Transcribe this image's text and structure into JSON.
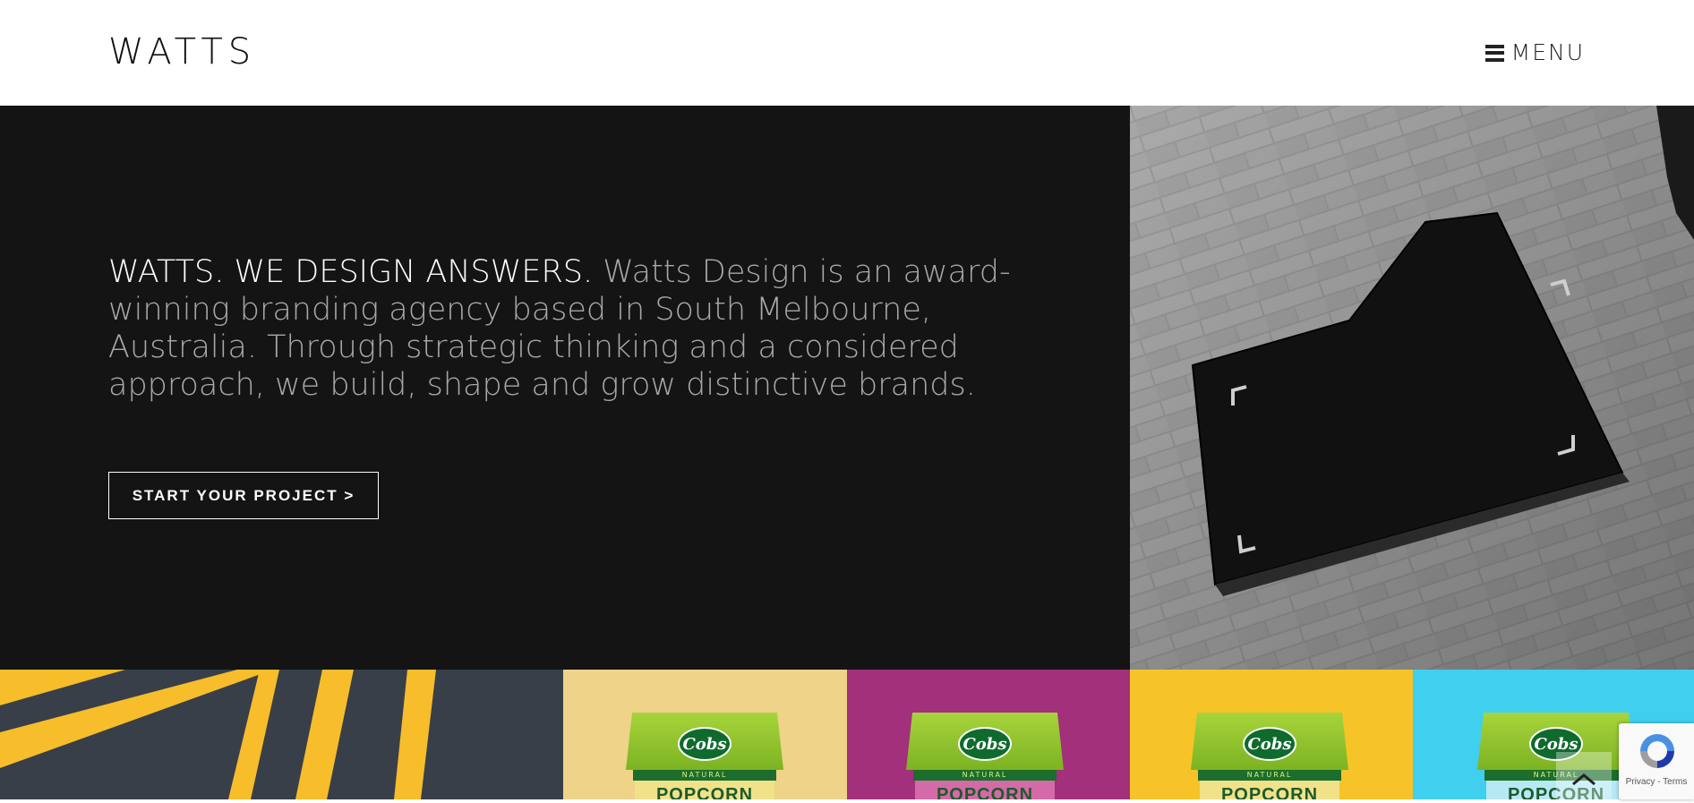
{
  "header": {
    "logo": "WATTS",
    "menu_label": "MENU"
  },
  "hero": {
    "lead": "WATTS. WE DESIGN ANSWERS.",
    "body": " Watts Design is an award-winning branding agency based in South Melbourne, Australia. Through strategic thinking and a considered approach, we build, shape and grow distinctive brands.",
    "cta_label": "START YOUR PROJECT  >"
  },
  "tiles": [
    {
      "brand": "Cobs",
      "band": "NATURAL",
      "product": "POPCORN",
      "color": "#efd388"
    },
    {
      "brand": "Cobs",
      "band": "NATURAL",
      "product": "POPCORN",
      "color": "#a3307b"
    },
    {
      "brand": "Cobs",
      "band": "NATURAL",
      "product": "POPCORN",
      "color": "#f6c428"
    },
    {
      "brand": "Cobs",
      "band": "NATURAL",
      "product": "POPCORN",
      "color": "#41cff0"
    }
  ],
  "recaptcha": {
    "terms": "Privacy - Terms"
  },
  "icons": {
    "menu": "hamburger-icon",
    "scroll_top": "chevron-up-icon",
    "recaptcha": "recaptcha-icon"
  }
}
